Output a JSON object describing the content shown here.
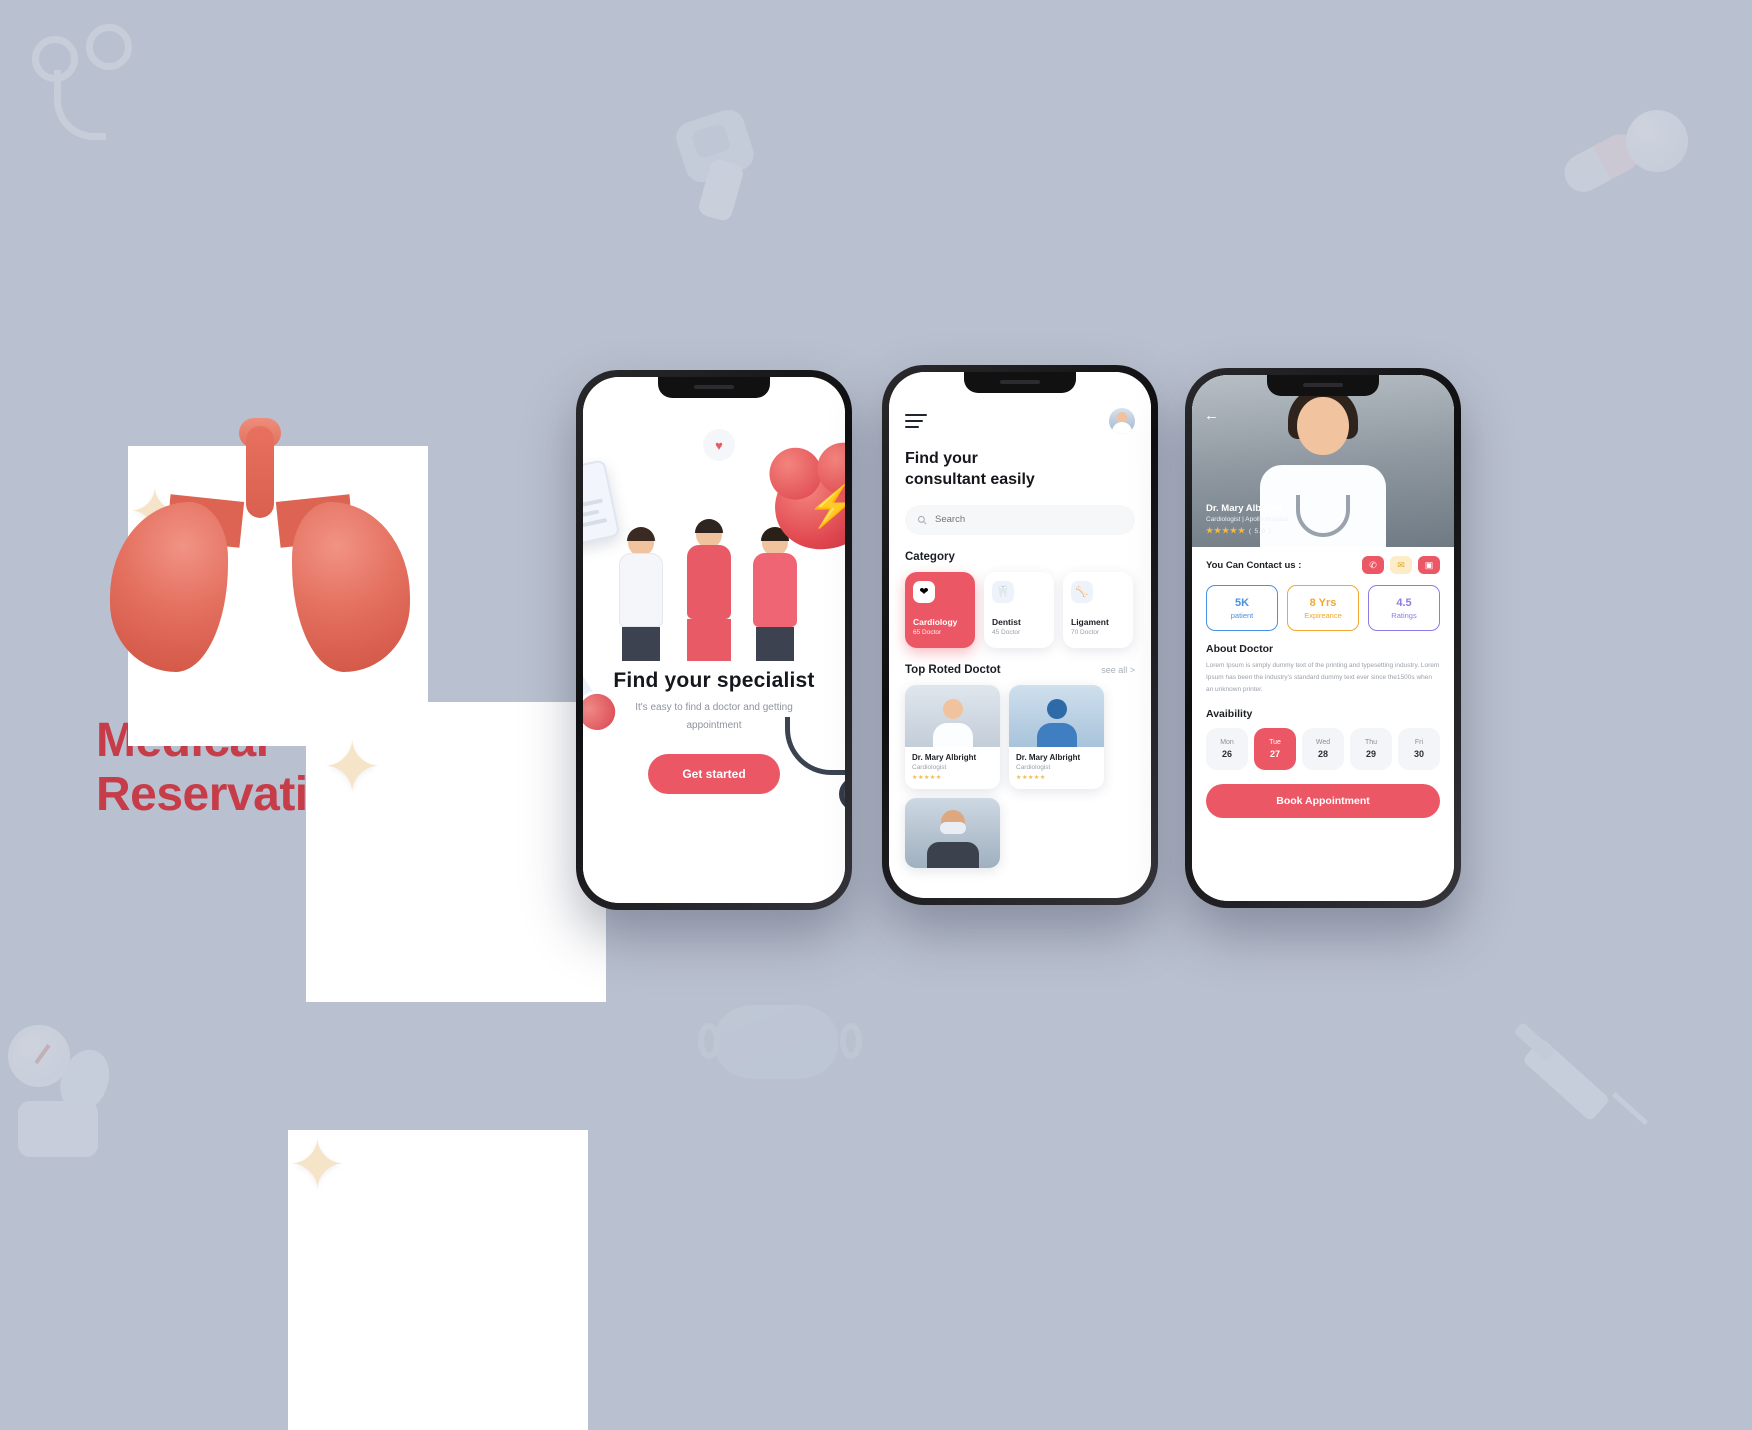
{
  "hero": {
    "title_line1": "Medical",
    "title_line2": "Reservation App",
    "accent_color": "#c63c48"
  },
  "theme": {
    "primary": "#ec5766",
    "background": "#b9c0cf",
    "text": "#15171c",
    "muted": "#9aa0ab"
  },
  "screen1": {
    "title": "Find your specialist",
    "subtitle": "It's easy to find a doctor and getting appointment",
    "cta_label": "Get started"
  },
  "screen2": {
    "title": "Find your\nconsultant easily",
    "search_placeholder": "Search",
    "search_value": "",
    "category_heading": "Category",
    "categories": [
      {
        "name": "Cardiology",
        "count": "65 Doctor",
        "icon": "heart-icon",
        "active": true
      },
      {
        "name": "Dentist",
        "count": "45 Doctor",
        "icon": "tooth-icon",
        "active": false
      },
      {
        "name": "Ligament",
        "count": "70 Doctor",
        "icon": "bone-icon",
        "active": false
      }
    ],
    "top_rated_heading": "Top Roted Doctot",
    "see_all": "see all >",
    "doctors": [
      {
        "name": "Dr. Mary Albright",
        "role": "Cardiologist",
        "stars": "★★★★★"
      },
      {
        "name": "Dr. Mary Albright",
        "role": "Cardiologist",
        "stars": "★★★★★"
      }
    ]
  },
  "screen3": {
    "doctor_name": "Dr. Mary Albright",
    "doctor_role": "Cardiologist | Apollo Hospital",
    "rating_stars": "★★★★★",
    "rating_value": "( 5.0 )",
    "contact_label": "You Can Contact us :",
    "contact_actions": [
      "call-icon",
      "chat-icon",
      "video-icon"
    ],
    "stats": [
      {
        "value": "5K",
        "label": "patient",
        "color": "#4a90e2"
      },
      {
        "value": "8 Yrs",
        "label": "Expireance",
        "color": "#f0a830"
      },
      {
        "value": "4.5",
        "label": "Ratings",
        "color": "#8a7de8"
      }
    ],
    "about_heading": "About Doctor",
    "about_text": "Lorem Ipsum is simply dummy text of the printing and typesetting industry. Lorem Ipsum has been the industry's standard dummy text ever since the1500s when an unknown printer.",
    "availability_heading": "Avaibility",
    "days": [
      {
        "weekday": "Mon",
        "date": "26",
        "selected": false
      },
      {
        "weekday": "Tue",
        "date": "27",
        "selected": true
      },
      {
        "weekday": "Wed",
        "date": "28",
        "selected": false
      },
      {
        "weekday": "Thu",
        "date": "29",
        "selected": false
      },
      {
        "weekday": "Fri",
        "date": "30",
        "selected": false
      }
    ],
    "book_label": "Book Appointment"
  }
}
